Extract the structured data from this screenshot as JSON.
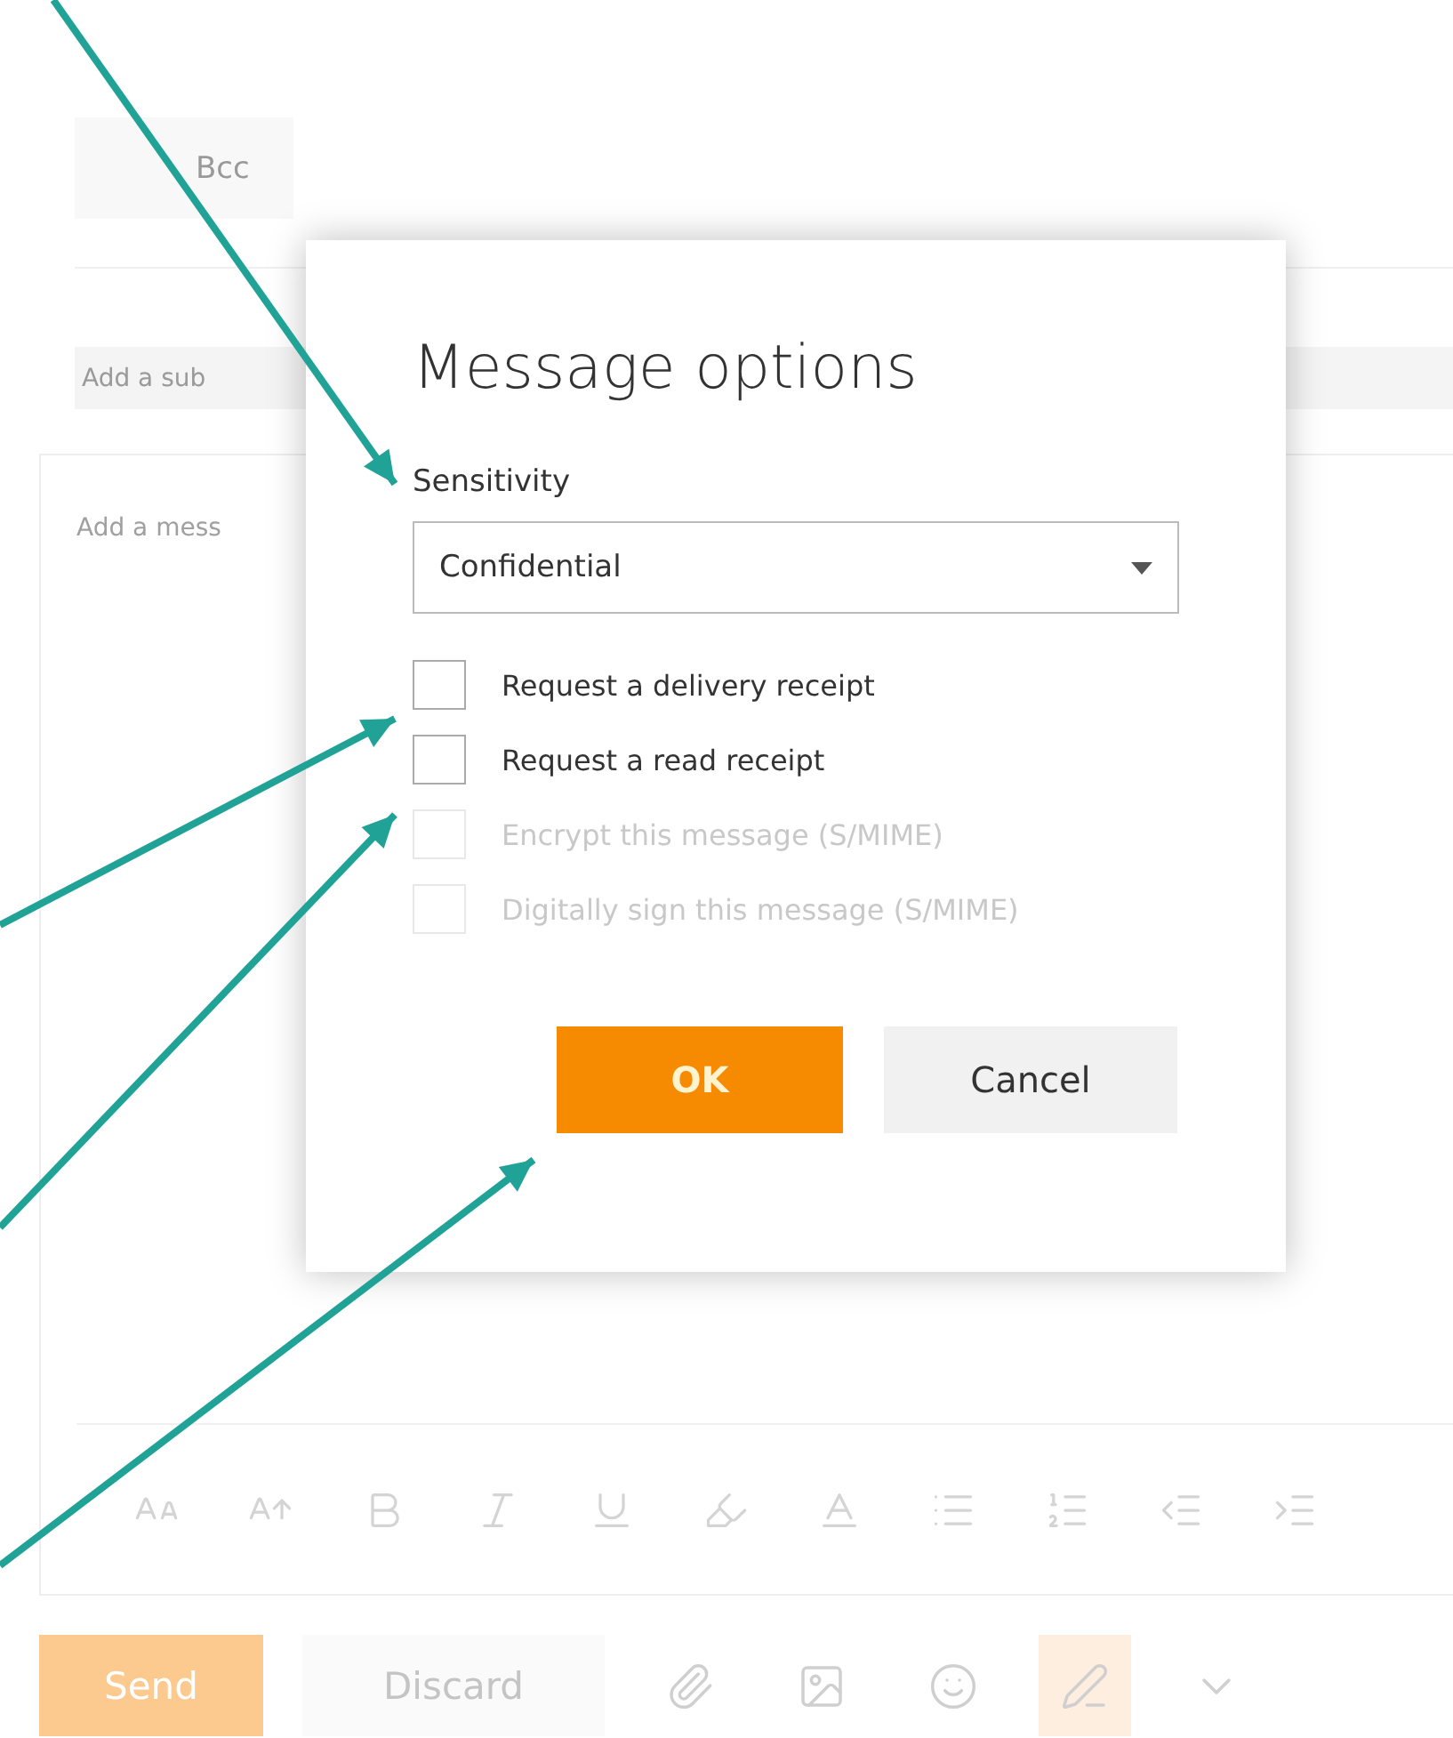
{
  "compose": {
    "bcc_button": "Bcc",
    "subject_placeholder": "Add a sub",
    "message_placeholder": "Add a mess",
    "toolbar": [
      {
        "kind": "font-size"
      },
      {
        "kind": "grow"
      },
      {
        "kind": "bold"
      },
      {
        "kind": "italic"
      },
      {
        "kind": "underline"
      },
      {
        "kind": "highlight"
      },
      {
        "kind": "font-color"
      },
      {
        "kind": "bullets"
      },
      {
        "kind": "numbering"
      },
      {
        "kind": "outdent"
      },
      {
        "kind": "indent"
      }
    ],
    "send_button": {
      "label": "Send",
      "disabled": true
    },
    "discard_button": "Discard",
    "actions": [
      {
        "kind": "attach"
      },
      {
        "kind": "picture"
      },
      {
        "kind": "emoji"
      },
      {
        "kind": "format",
        "selected": true
      },
      {
        "kind": "more"
      }
    ]
  },
  "dialog": {
    "title": "Message options",
    "sensitivity_label": "Sensitivity",
    "sensitivity_value": "Confidential",
    "options": [
      {
        "label": "Request a delivery receipt",
        "checked": false,
        "disabled": false
      },
      {
        "label": "Request a read receipt",
        "checked": false,
        "disabled": false
      },
      {
        "label": "Encrypt this message (S/MIME)",
        "checked": false,
        "disabled": true
      },
      {
        "label": "Digitally sign this message (S/MIME)",
        "checked": false,
        "disabled": true
      }
    ],
    "ok_button": "OK",
    "cancel_button": "Cancel"
  }
}
